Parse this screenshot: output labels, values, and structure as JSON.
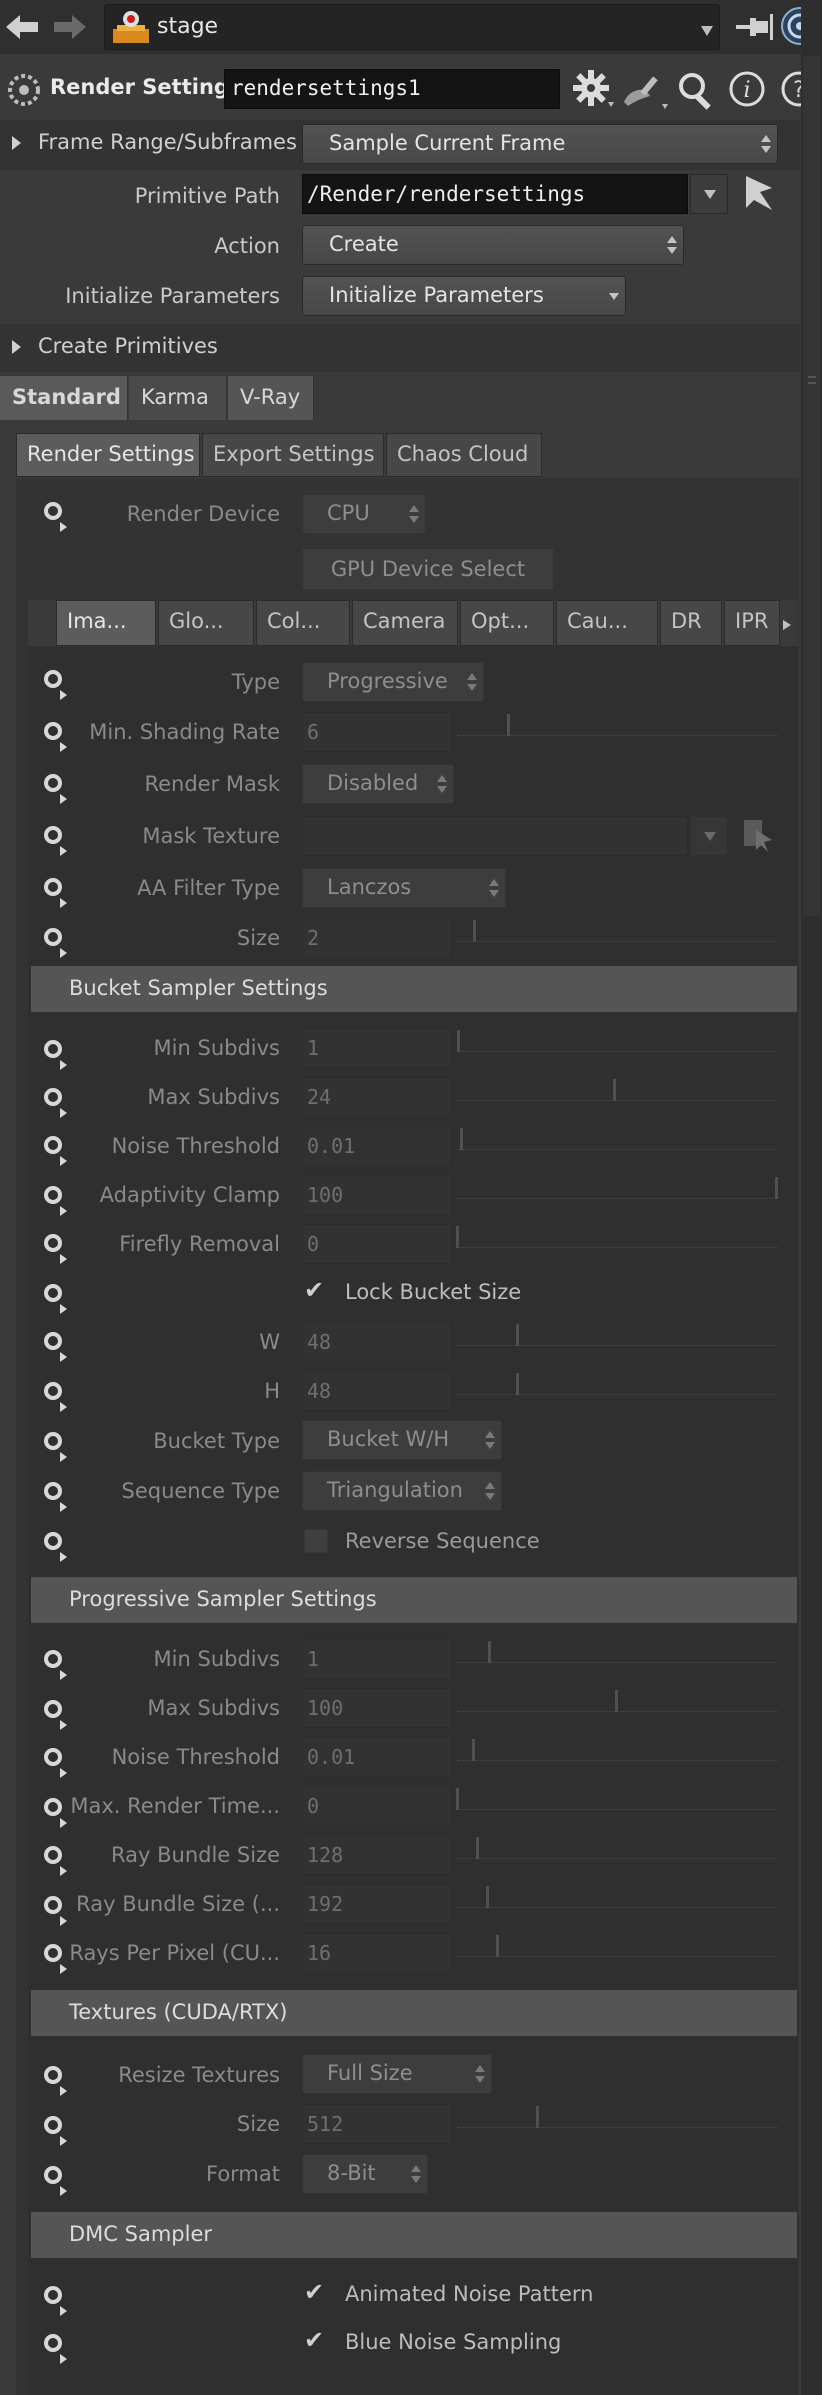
{
  "topbar": {
    "path": "stage"
  },
  "header": {
    "title": "Render Settings",
    "node_name": "rendersettings1"
  },
  "params": {
    "frame_range_label": "Frame Range/Subframes",
    "frame_range_value": "Sample Current Frame",
    "primitive_path_label": "Primitive Path",
    "primitive_path_value": "/Render/rendersettings",
    "action_label": "Action",
    "action_value": "Create",
    "init_label": "Initialize Parameters",
    "init_value": "Initialize Parameters",
    "create_prims_label": "Create Primitives"
  },
  "tabs": [
    "Standard",
    "Karma",
    "V-Ray"
  ],
  "subtabs": [
    "Render Settings",
    "Export Settings",
    "Chaos Cloud"
  ],
  "device": {
    "label": "Render Device",
    "value": "CPU",
    "gpu_button": "GPU Device Select"
  },
  "image_tabs": [
    "Ima...",
    "Glo...",
    "Col...",
    "Camera",
    "Opt...",
    "Cau...",
    "DR",
    "IPR"
  ],
  "image": {
    "type_label": "Type",
    "type_value": "Progressive",
    "shading_label": "Min. Shading Rate",
    "shading_value": "6",
    "mask_label": "Render Mask",
    "mask_value": "Disabled",
    "mask_tex_label": "Mask Texture",
    "aa_label": "AA Filter Type",
    "aa_value": "Lanczos",
    "size_label": "Size",
    "size_value": "2"
  },
  "bucket": {
    "title": "Bucket Sampler Settings",
    "min_label": "Min Subdivs",
    "min_value": "1",
    "max_label": "Max Subdivs",
    "max_value": "24",
    "noise_label": "Noise Threshold",
    "noise_value": "0.01",
    "clamp_label": "Adaptivity Clamp",
    "clamp_value": "100",
    "firefly_label": "Firefly Removal",
    "firefly_value": "0",
    "lock_label": "Lock Bucket Size",
    "w_label": "W",
    "w_value": "48",
    "h_label": "H",
    "h_value": "48",
    "btype_label": "Bucket Type",
    "btype_value": "Bucket W/H",
    "seq_label": "Sequence Type",
    "seq_value": "Triangulation",
    "reverse_label": "Reverse Sequence"
  },
  "progressive": {
    "title": "Progressive Sampler Settings",
    "min_label": "Min Subdivs",
    "min_value": "1",
    "max_label": "Max Subdivs",
    "max_value": "100",
    "noise_label": "Noise Threshold",
    "noise_value": "0.01",
    "time_label": "Max. Render Time...",
    "time_value": "0",
    "ray_label": "Ray Bundle Size",
    "ray_value": "128",
    "ray2_label": "Ray Bundle Size (...",
    "ray2_value": "192",
    "rpp_label": "Rays Per Pixel (CU...",
    "rpp_value": "16"
  },
  "textures": {
    "title": "Textures (CUDA/RTX)",
    "resize_label": "Resize Textures",
    "resize_value": "Full Size",
    "size_label": "Size",
    "size_value": "512",
    "format_label": "Format",
    "format_value": "8-Bit"
  },
  "dmc": {
    "title": "DMC Sampler",
    "animated_label": "Animated Noise Pattern",
    "blue_label": "Blue Noise Sampling"
  }
}
